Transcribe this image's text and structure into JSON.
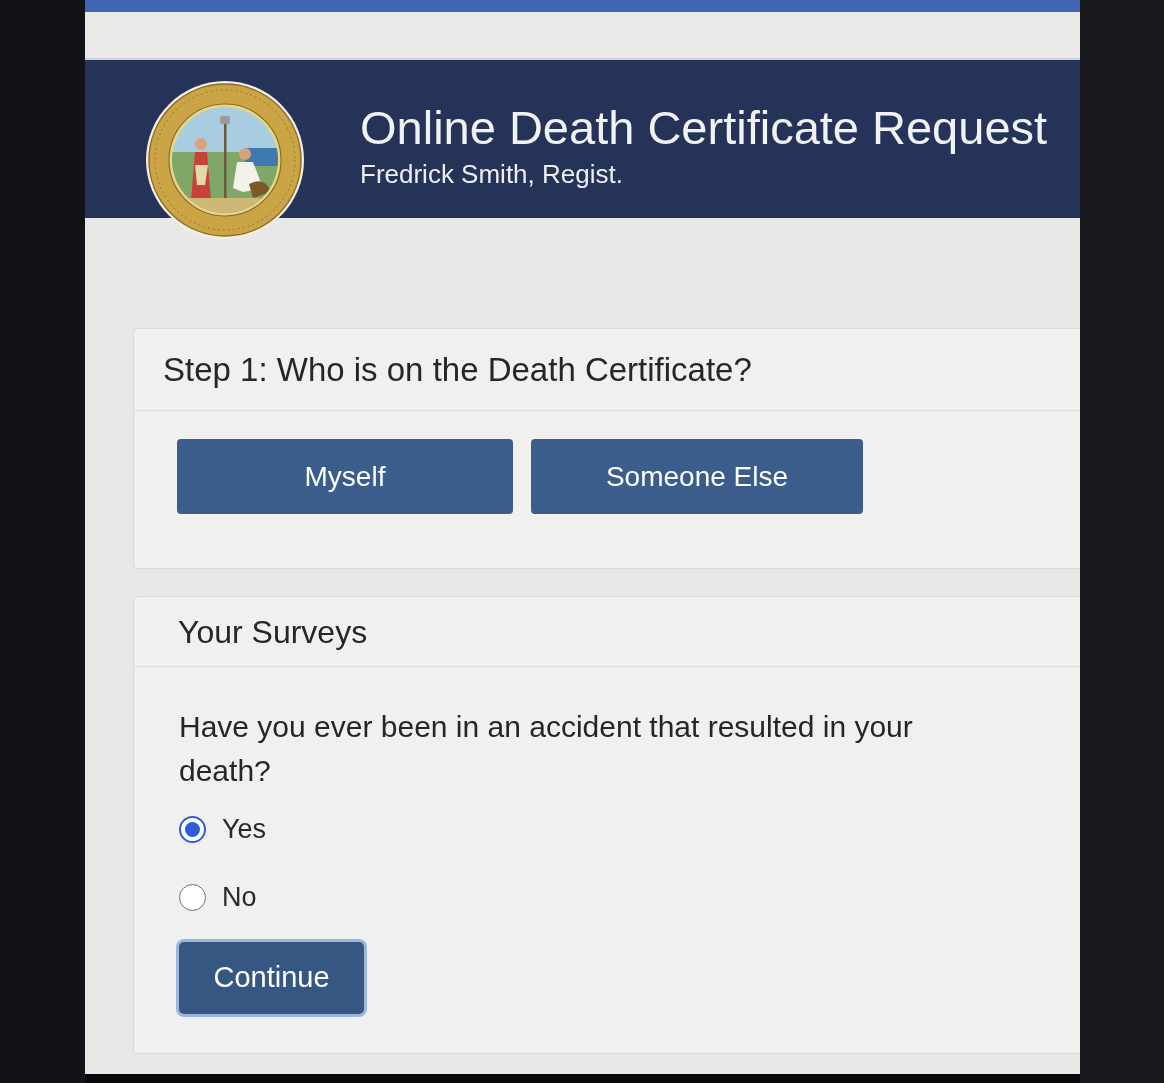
{
  "header": {
    "title": "Online Death Certificate Request",
    "subtitle": "Fredrick Smith, Regist."
  },
  "step_card": {
    "heading": "Step 1: Who is on the Death Certificate?",
    "buttons": [
      "Myself",
      "Someone Else"
    ]
  },
  "survey_card": {
    "heading": "Your Surveys",
    "question": "Have you ever been in an accident that resulted in your death?",
    "options": [
      {
        "label": "Yes",
        "selected": true
      },
      {
        "label": "No",
        "selected": false
      }
    ],
    "button": {
      "label": "Continue",
      "focused": true
    }
  }
}
